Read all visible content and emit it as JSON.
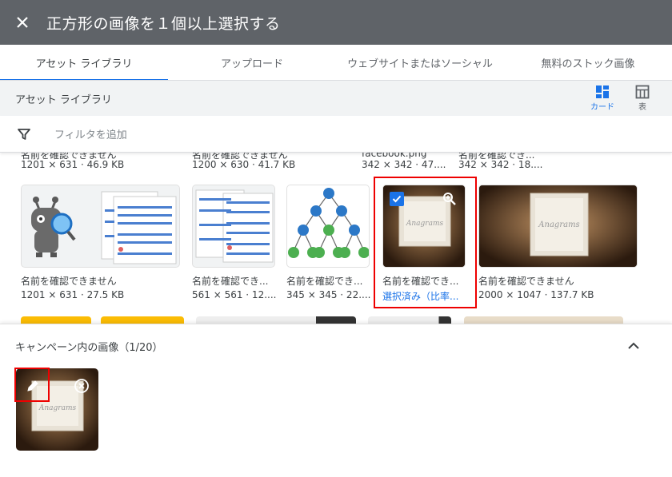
{
  "header": {
    "close_icon": "close-icon",
    "title": "正方形の画像を１個以上選択する"
  },
  "tabs": [
    {
      "label": "アセット ライブラリ",
      "active": true
    },
    {
      "label": "アップロード"
    },
    {
      "label": "ウェブサイトまたはソーシャル"
    },
    {
      "label": "無料のストック画像"
    }
  ],
  "subbar": {
    "title": "アセット ライブラリ",
    "card_label": "カード",
    "table_label": "表"
  },
  "filter": {
    "icon": "filter-icon",
    "placeholder": "フィルタを追加"
  },
  "row0": {
    "names": [
      "名前を確認できません",
      "名前を確認できません",
      "facebook.png",
      "名前を確認でき..."
    ],
    "metas": [
      "1201 × 631 · 46.9 KB",
      "1200 × 630 · 41.7 KB",
      "342 × 342 · 47....",
      "342 × 342 · 18...."
    ]
  },
  "cards": [
    {
      "name": "名前を確認できません",
      "meta": "1201 × 631 · 27.5 KB"
    },
    {
      "name": "名前を確認でき...",
      "meta": "561 × 561 · 12...."
    },
    {
      "name": "名前を確認でき...",
      "meta": "345 × 345 · 22...."
    },
    {
      "name": "名前を確認でき...",
      "meta": "選択済み（比率...",
      "selected": true
    },
    {
      "name": "名前を確認できません",
      "meta": "2000 × 1047 · 137.7 KB"
    }
  ],
  "campaign": {
    "title": "キャンペーン内の画像（1/20）",
    "collapse_icon": "chevron-up-icon"
  },
  "colors": {
    "header_bg": "#5f6368",
    "accent": "#1a73e8",
    "highlight": "#e00000"
  }
}
